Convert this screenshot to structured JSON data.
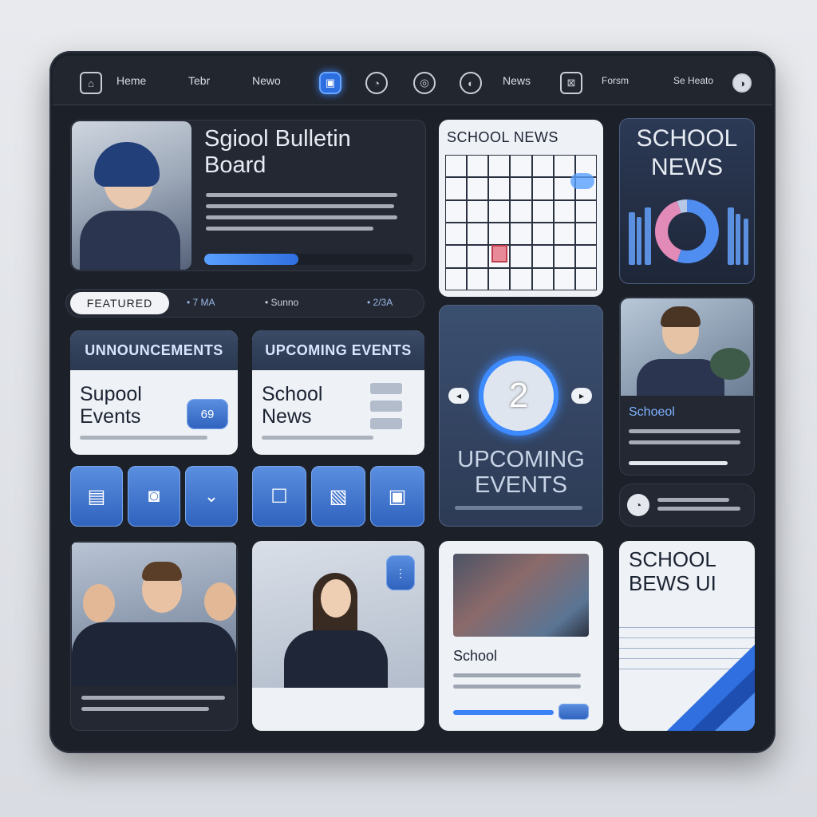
{
  "nav": {
    "items": [
      {
        "label": "Heme",
        "icon": "home-icon"
      },
      {
        "label": "Tebr",
        "icon": ""
      },
      {
        "label": "Newo",
        "icon": ""
      },
      {
        "label": "",
        "icon": "calendar-icon"
      },
      {
        "label": "",
        "icon": "bell-icon"
      },
      {
        "label": "",
        "icon": "search-icon"
      },
      {
        "label": "",
        "icon": "chat-icon"
      },
      {
        "label": "News",
        "icon": ""
      },
      {
        "label": "",
        "icon": "bookmark-icon"
      },
      {
        "label": "Forsm",
        "icon": ""
      },
      {
        "label": "Se Heato",
        "icon": "profile-icon"
      }
    ]
  },
  "bulletin": {
    "title": "Sgiool Bulletin Board",
    "progress": 0.45
  },
  "featured": {
    "label": "Featured",
    "items": [
      "• 7 MA",
      "• Sunno",
      "• 2/3A"
    ]
  },
  "announcements": {
    "title": "UNNOUNCEMENTS",
    "body": "Supool Events",
    "badge": "69"
  },
  "upcoming_card": {
    "title": "UPCOMING EVENTS",
    "body": "School News"
  },
  "calendar_card": {
    "title": "SCHOOL NEWS"
  },
  "events_panel": {
    "number": "2",
    "title": "UPCOMING EVENTS"
  },
  "news_chart": {
    "title": "SCHOOL NEWS"
  },
  "student_card": {
    "title": "Schoeol"
  },
  "article_card": {
    "title": "School"
  },
  "ui_card": {
    "title": "SCHOOL BEWS UI"
  },
  "colors": {
    "accent": "#2f6fe0",
    "panel": "#232833",
    "bezel": "#1c2029"
  }
}
